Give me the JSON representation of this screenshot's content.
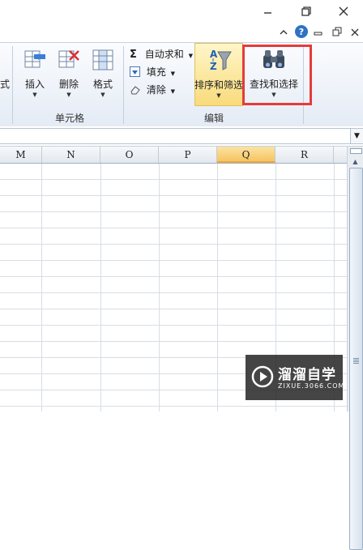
{
  "window": {
    "controls": [
      "minimize-icon",
      "restore-icon",
      "close-icon"
    ]
  },
  "help_bar": {
    "icons": [
      "ribbon-collapse-icon",
      "help-icon",
      "minimize-doc-icon",
      "restore-doc-icon",
      "close-doc-icon"
    ]
  },
  "ribbon": {
    "cut_left_label": "式",
    "cells_group": {
      "label": "单元格",
      "buttons": [
        {
          "label": "插入",
          "icon": "insert-cells-icon"
        },
        {
          "label": "删除",
          "icon": "delete-cells-icon"
        },
        {
          "label": "格式",
          "icon": "format-cells-icon"
        }
      ]
    },
    "editing_group": {
      "label": "编辑",
      "autosum": {
        "symbol": "Σ",
        "label": "自动求和"
      },
      "fill": {
        "label": "填充"
      },
      "clear": {
        "label": "清除"
      },
      "sort_filter": {
        "label": "排序和筛选"
      },
      "find_select": {
        "label": "查找和选择"
      }
    }
  },
  "formula_bar": {
    "value": ""
  },
  "sheet": {
    "columns": [
      "M",
      "N",
      "O",
      "P",
      "Q",
      "R"
    ],
    "selected_column": "Q"
  },
  "watermark": {
    "title": "溜溜自学",
    "subtitle": "ZIXUE.3066.COM"
  },
  "colors": {
    "highlight": "#e53b3b",
    "selected_header": "#f6c560",
    "ribbon_bg": "#e4ebf5"
  }
}
